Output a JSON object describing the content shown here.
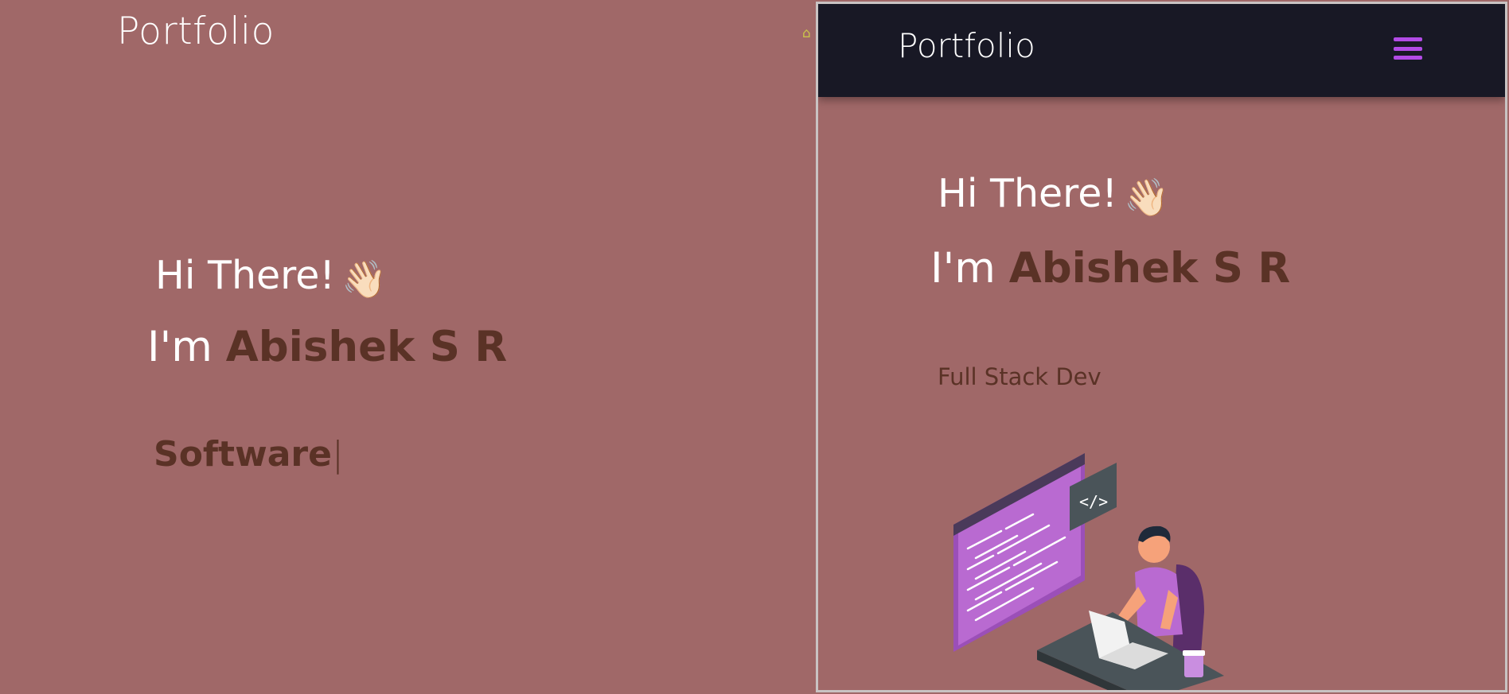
{
  "desktop": {
    "logo": "Portfolio",
    "greeting": "Hi There!",
    "greeting_emoji": "👋🏻",
    "name_prefix": "I'm",
    "name": "Abishek S R",
    "typed_text": "Software",
    "cursor": "|"
  },
  "mobile": {
    "logo": "Portfolio",
    "greeting": "Hi There!",
    "greeting_emoji": "👋🏻",
    "name_prefix": "I'm",
    "name": "Abishek S R",
    "role": "Full Stack Dev",
    "illustration_code_tag": "</>"
  },
  "colors": {
    "background": "#a06868",
    "navbar": "#181825",
    "accent_purple": "#b24be6",
    "name_brown": "#5a3226"
  },
  "icons": {
    "nav_home": "home-icon",
    "menu": "hamburger-menu-icon"
  }
}
